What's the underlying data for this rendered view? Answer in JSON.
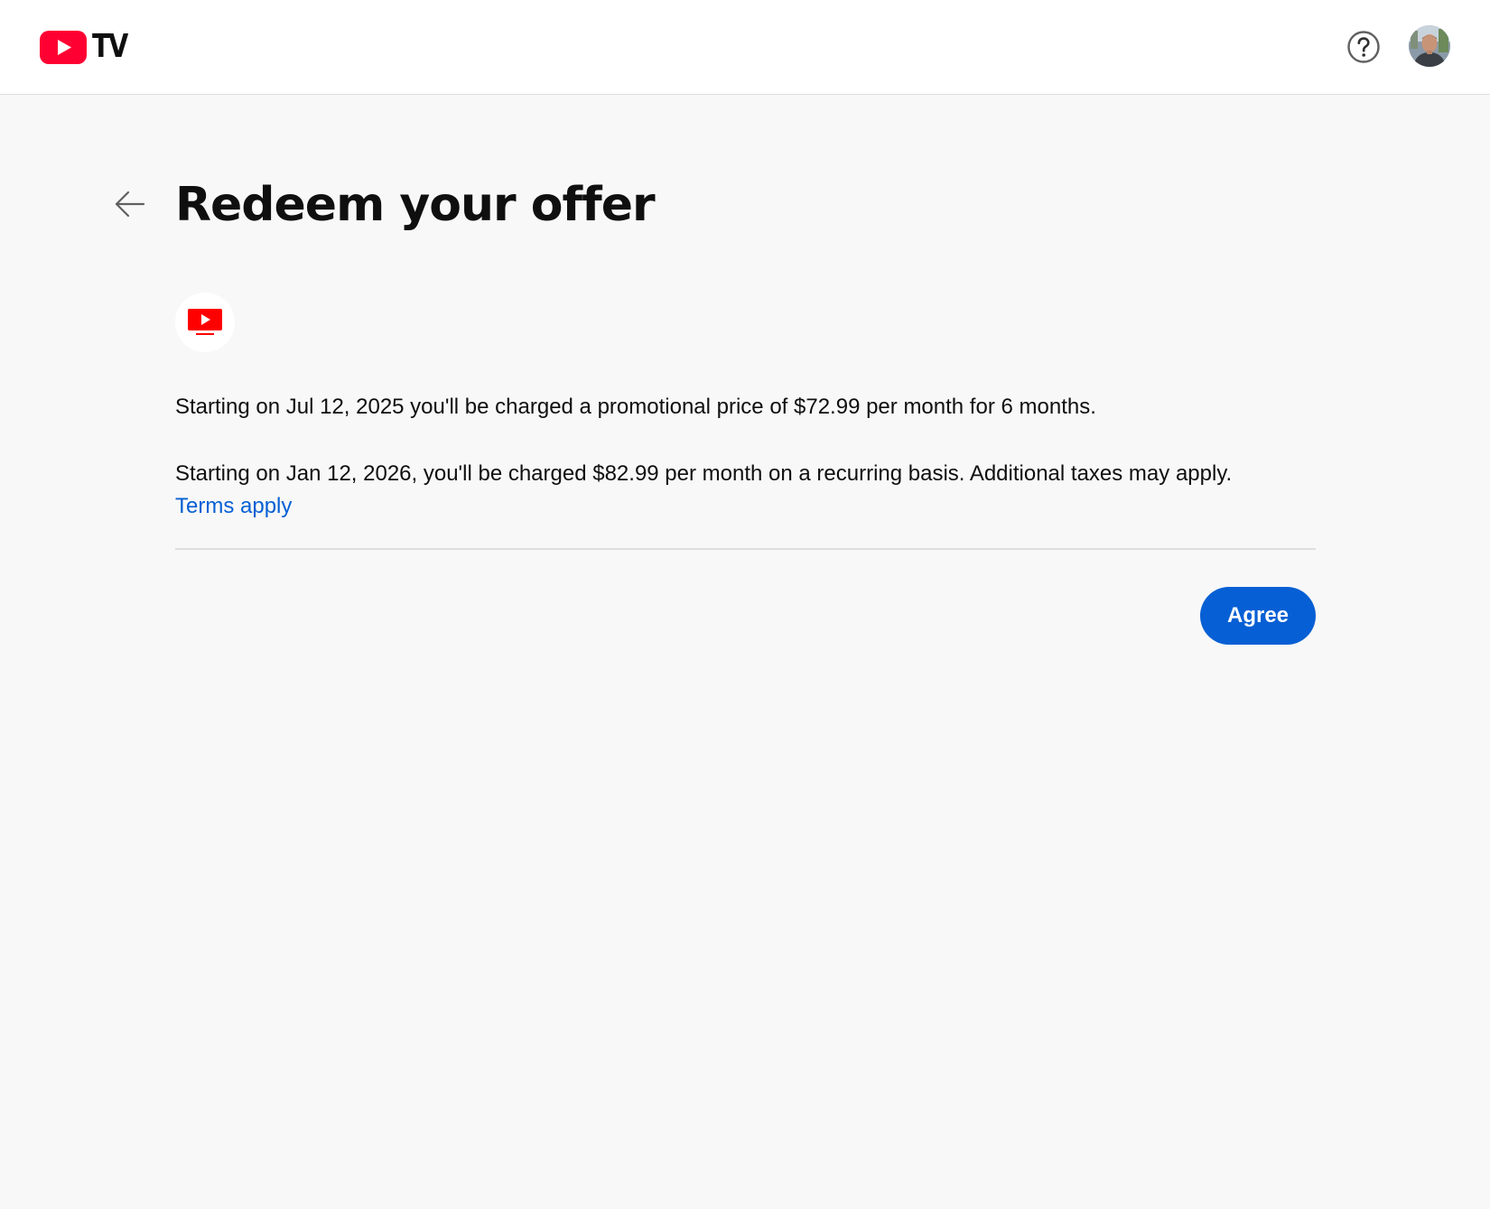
{
  "header": {
    "logo_text": "TV",
    "logo_icon": "youtube-play-icon",
    "help_icon": "help-circle-icon",
    "avatar_icon": "user-avatar"
  },
  "page": {
    "back_icon": "arrow-left-icon",
    "title": "Redeem your offer",
    "offer_icon": "youtube-tv-icon",
    "promo_text": "Starting on Jul 12, 2025 you'll be charged a promotional price of $72.99 per month for 6 months.",
    "recurring_text": "Starting on Jan 12, 2026, you'll be charged $82.99 per month on a recurring basis. Additional taxes may apply.",
    "terms_link": "Terms apply",
    "agree_label": "Agree"
  },
  "colors": {
    "brand_red": "#ff0033",
    "link_blue": "#065fd4",
    "button_blue": "#065fd4",
    "background": "#f8f8f8"
  }
}
